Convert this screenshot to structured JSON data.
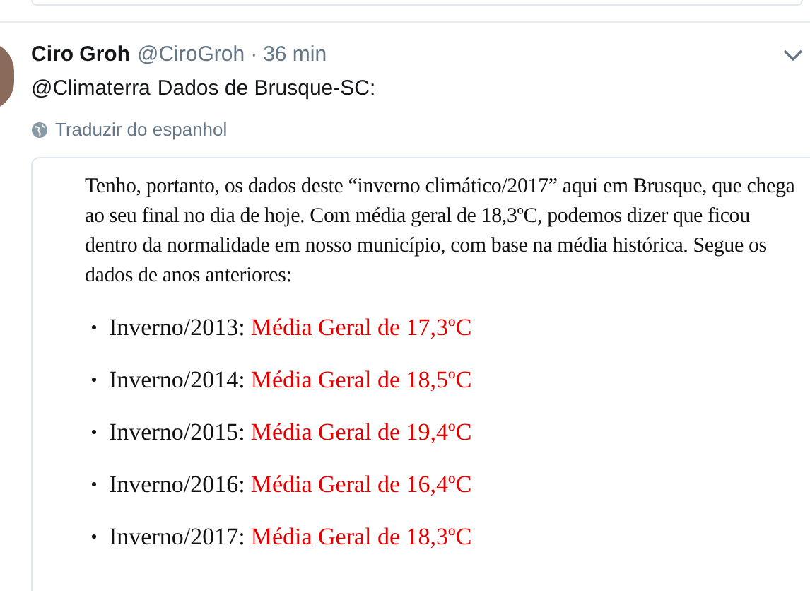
{
  "tweet": {
    "name": "Ciro Groh",
    "handle": "@CiroGroh",
    "separator": "·",
    "time": "36 min",
    "mention": "@Climaterra",
    "text": "Dados de Brusque-SC:",
    "translate": "Traduzir do espanhol"
  },
  "embedded": {
    "paragraph": "Tenho, portanto, os dados deste “inverno climático/2017” aqui em Brusque, que chega ao seu final no dia de hoje. Com média geral de 18,3ºC, podemos dizer que ficou dentro da normalidade em nosso município, com base na média histórica. Segue os dados de anos anteriores:",
    "items": [
      {
        "label": "Inverno/2013:",
        "value": "Média Geral de 17,3ºC"
      },
      {
        "label": "Inverno/2014:",
        "value": "Média Geral de 18,5ºC"
      },
      {
        "label": "Inverno/2015:",
        "value": "Média Geral de 19,4ºC"
      },
      {
        "label": "Inverno/2016:",
        "value": "Média Geral de 16,4ºC"
      },
      {
        "label": "Inverno/2017:",
        "value": "Média Geral de 18,3ºC"
      }
    ]
  }
}
